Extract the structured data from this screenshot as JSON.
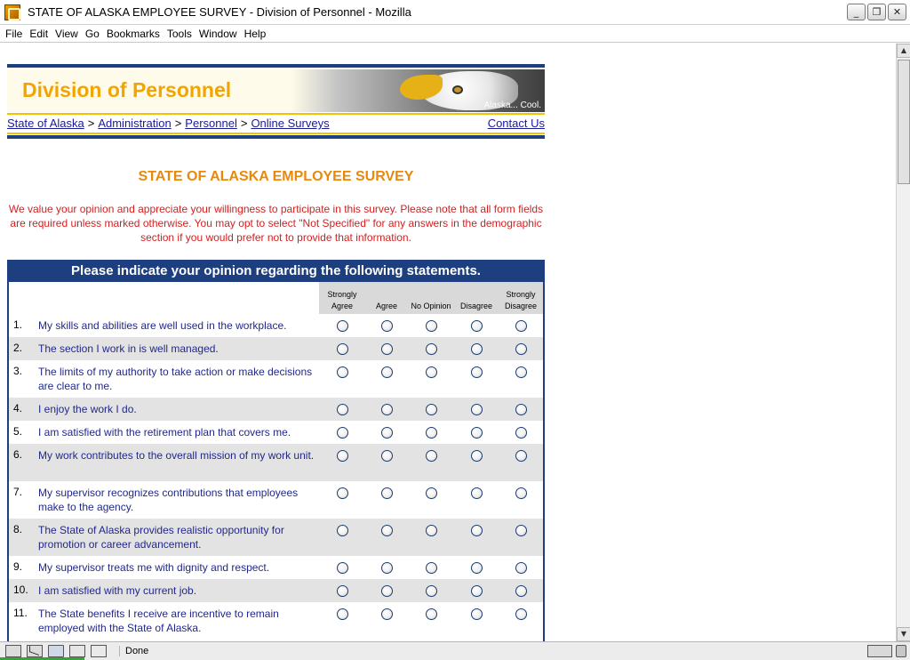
{
  "window": {
    "title": "STATE OF ALASKA EMPLOYEE SURVEY - Division of Personnel - Mozilla",
    "buttons": [
      "_",
      "❐",
      "✕"
    ]
  },
  "menu": [
    "File",
    "Edit",
    "View",
    "Go",
    "Bookmarks",
    "Tools",
    "Window",
    "Help"
  ],
  "banner": {
    "title": "Division of Personnel",
    "tagline": "Alaska... Cool."
  },
  "breadcrumb": {
    "links": [
      "State of Alaska",
      "Administration",
      "Personnel",
      "Online Surveys"
    ],
    "separator": ">",
    "contact": "Contact Us"
  },
  "survey": {
    "heading": "STATE OF ALASKA EMPLOYEE SURVEY",
    "intro": "We value your opinion and appreciate your willingness to participate in this survey. Please note that all form fields are required unless marked otherwise. You may opt to select \"Not Specified\" for any answers in the demographic section if you would prefer not to provide that information.",
    "table_title": "Please indicate your opinion regarding the following statements.",
    "columns": [
      "Strongly Agree",
      "Agree",
      "No Opinion",
      "Disagree",
      "Strongly Disagree"
    ],
    "questions": [
      {
        "num": "1.",
        "text": "My skills and abilities are well used in the workplace.",
        "lines": 1
      },
      {
        "num": "2.",
        "text": "The section I work in is well managed.",
        "lines": 1
      },
      {
        "num": "3.",
        "text": "The limits of my authority to take action or make decisions are clear to me.",
        "lines": 2
      },
      {
        "num": "4.",
        "text": "I enjoy the work I do.",
        "lines": 1
      },
      {
        "num": "5.",
        "text": "I am satisfied with the retirement plan that covers me.",
        "lines": 1
      },
      {
        "num": "6.",
        "text": "My work contributes to the overall mission of my work unit.",
        "lines": 2
      },
      {
        "num": "7.",
        "text": "My supervisor recognizes contributions that employees make to the agency.",
        "lines": 2
      },
      {
        "num": "8.",
        "text": "The State of Alaska provides realistic opportunity for promotion or career advancement.",
        "lines": 2
      },
      {
        "num": "9.",
        "text": "My supervisor treats me with dignity and respect.",
        "lines": 1
      },
      {
        "num": "10.",
        "text": "I am satisfied with my current job.",
        "lines": 1
      },
      {
        "num": "11.",
        "text": "The State benefits I receive are incentive to remain employed with the State of Alaska.",
        "lines": 2
      }
    ]
  },
  "status": {
    "text": "Done"
  },
  "colors": {
    "navy": "#1d3f80",
    "gold": "#f2a400",
    "heading_orange": "#e8890c",
    "intro_red": "#d41f1f",
    "question_text": "#22288a",
    "row_alt": "#e3e3e3"
  }
}
